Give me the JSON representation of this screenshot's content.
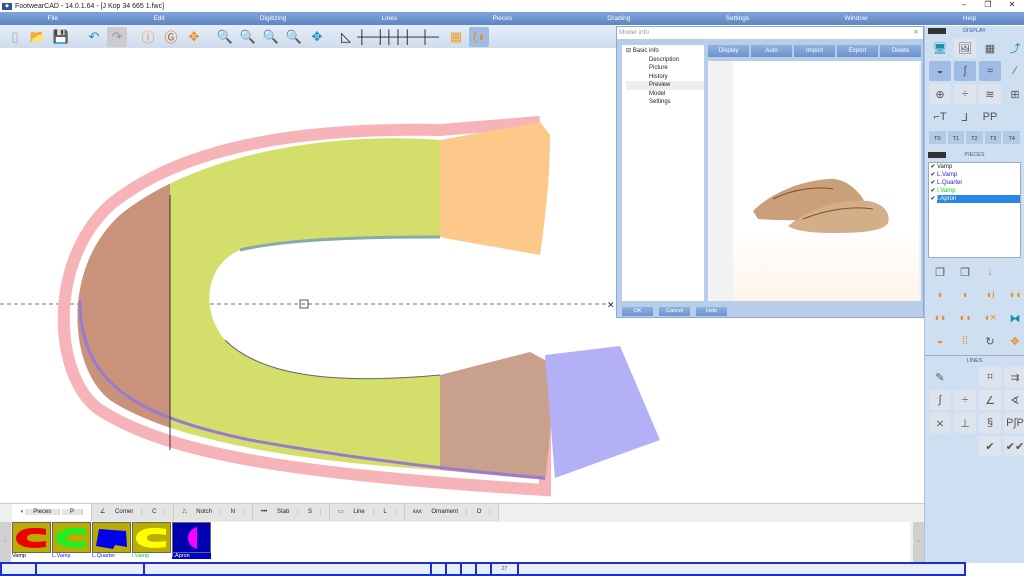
{
  "app": {
    "title": "FootwearCAD - 14.0.1.64 - [J Kop 34 665 1.fwc]"
  },
  "menu": [
    "File",
    "Edit",
    "Digitizing",
    "Lines",
    "Pieces",
    "Grading",
    "Settings",
    "Window",
    "Help"
  ],
  "dialog": {
    "title": "Model info",
    "tree_root": "Basic info",
    "tree_items": [
      "Description",
      "Picture",
      "History",
      "Preview",
      "Model",
      "Settings"
    ],
    "tabs": [
      "Display",
      "Auto",
      "Import",
      "Export",
      "Delete"
    ],
    "buttons": [
      "OK",
      "Cancel",
      "Help"
    ]
  },
  "right_panel": {
    "display_title": "DISPLAY",
    "t_buttons": [
      "T0",
      "T1",
      "T2",
      "T3",
      "T4"
    ],
    "pieces_title": "PIECES",
    "lines_title": "LINES",
    "pieces": [
      {
        "name": "Vamp",
        "color": "#222222",
        "checked": true
      },
      {
        "name": "L.Vamp",
        "color": "#2020e0",
        "checked": true
      },
      {
        "name": "L.Quarter",
        "color": "#2020e0",
        "checked": true
      },
      {
        "name": "I.Vamp",
        "color": "#20c020",
        "checked": true
      },
      {
        "name": "I.Apron",
        "color": "#ffffff",
        "checked": true,
        "selected": true
      }
    ]
  },
  "bottom": {
    "tabs": [
      {
        "label": "Pieces",
        "key": "P"
      },
      {
        "label": "Corner",
        "key": "C"
      },
      {
        "label": "Notch",
        "key": "N"
      },
      {
        "label": "Stab",
        "key": "S"
      },
      {
        "label": "Line",
        "key": "L"
      },
      {
        "label": "Ornament",
        "key": "O"
      }
    ],
    "thumbs": [
      {
        "name": "Vamp",
        "color": "#000000"
      },
      {
        "name": "L.Vamp",
        "color": "#2020e0"
      },
      {
        "name": "L.Quarter",
        "color": "#2020e0"
      },
      {
        "name": "I.Vamp",
        "color": "#20c020"
      },
      {
        "name": "I.Apron",
        "color": "#ffffff"
      }
    ]
  },
  "status": {
    "value": "27"
  }
}
